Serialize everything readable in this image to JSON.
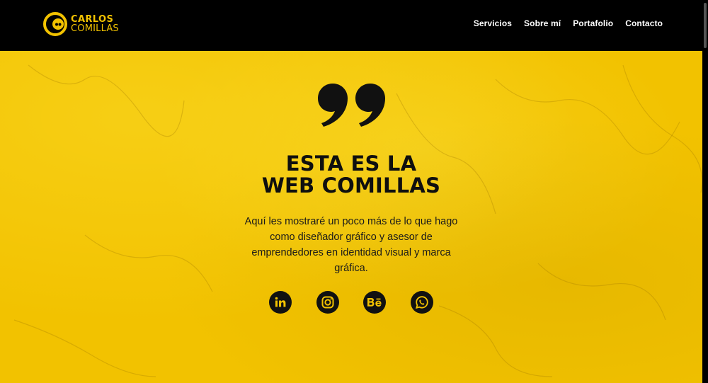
{
  "header": {
    "logo": {
      "line1": "CARLOS",
      "line2": "COMILLAS"
    },
    "nav": [
      {
        "label": "Servicios"
      },
      {
        "label": "Sobre mí"
      },
      {
        "label": "Portafolio"
      },
      {
        "label": "Contacto"
      }
    ]
  },
  "hero": {
    "icon": "closing-quote-icon",
    "title_line1": "ESTA ES LA",
    "title_line2": "WEB COMILLAS",
    "description": "Aquí les mostraré un poco más de lo que hago como diseñador gráfico y asesor de emprendedores en identidad visual y marca gráfica."
  },
  "socials": [
    {
      "icon": "linkedin-icon"
    },
    {
      "icon": "instagram-icon"
    },
    {
      "icon": "behance-icon"
    },
    {
      "icon": "whatsapp-icon"
    }
  ],
  "colors": {
    "brand_yellow": "#f2c200",
    "header_bg": "#000000",
    "text_dark": "#111111"
  }
}
